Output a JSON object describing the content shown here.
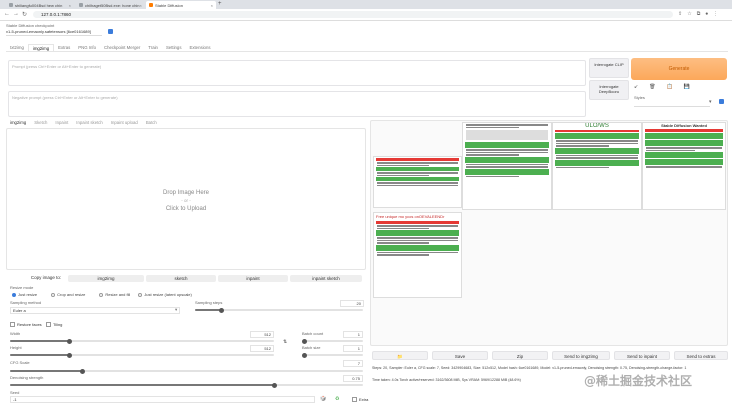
{
  "browser": {
    "tabs": [
      {
        "label": "shiliangfu004Bsd hew chin"
      },
      {
        "label": "chilhaget50Bsd.exe: hone chin"
      },
      {
        "label": "Stable Diffusion"
      }
    ],
    "url": "127.0.0.1:7860"
  },
  "app": {
    "checkpoint_label": "Stable Diffusion checkpoint",
    "checkpoint_value": "v1-5-pruned-emaonly.safetensors [6ce0161689]",
    "main_tabs": [
      "txt2img",
      "img2img",
      "Extras",
      "PNG Info",
      "Checkpoint Merger",
      "Train",
      "Settings",
      "Extensions"
    ],
    "selected_main_tab": "img2img",
    "prompt_placeholder": "Prompt (press Ctrl+Enter or Alt+Enter to generate)",
    "negative_placeholder": "Negative prompt (press Ctrl+Enter or Alt+Enter to generate)",
    "interrogate_clip": "Interrogate CLIP",
    "interrogate_deepbooru": "Interrogate DeepBooru",
    "generate": "Generate",
    "styles_label": "Styles",
    "utility_icons": [
      "↙",
      "🗑",
      "📋",
      "💾"
    ]
  },
  "input_panel": {
    "tabs": [
      "img2img",
      "Sketch",
      "Inpaint",
      "Inpaint sketch",
      "Inpaint upload",
      "Batch"
    ],
    "drop_text": "Drop Image Here",
    "or_text": "- or -",
    "click_text": "Click to Upload",
    "copy_label": "Copy image to:",
    "copy_targets": [
      "img2img",
      "sketch",
      "inpaint",
      "inpaint sketch"
    ],
    "resize_label": "Resize mode",
    "resize_options": [
      "Just resize",
      "Crop and resize",
      "Resize and fill",
      "Just resize (latent upscale)"
    ],
    "resize_selected": "Just resize",
    "sampling_method_label": "Sampling method",
    "sampling_method": "Euler a",
    "sampling_steps_label": "Sampling steps",
    "sampling_steps": "20",
    "restore_faces": "Restore faces",
    "tiling": "Tiling",
    "width_label": "Width",
    "width": "512",
    "height_label": "Height",
    "height": "512",
    "batch_count_label": "Batch count",
    "batch_count": "1",
    "batch_size_label": "Batch size",
    "batch_size": "1",
    "cfg_label": "CFG Scale",
    "cfg": "7",
    "denoise_label": "Denoising strength",
    "denoise": "0.75",
    "seed_label": "Seed",
    "seed": "-1",
    "extra_label": "Extra",
    "script_label": "Script"
  },
  "output_panel": {
    "buttons": [
      "📁",
      "Save",
      "Zip",
      "Send to img2img",
      "Send to inpaint",
      "Send to extras"
    ],
    "info": "Steps: 20, Sampler: Euler a, CFG scale: 7, Seed: 3429904683, Size: 512x512, Model hash: 6ce0161689, Model: v1-5-pruned-emaonly, Denoising strength: 0.75, Denoising-strength-change-factor: 1",
    "time": "Time taken: 4.0s  Torch active/reserved: 3162/3608 MiB, Sys VRAM: 5969/12288 MiB (48.6%)"
  },
  "thumbnails": {
    "t2_heading": "",
    "t3_heading": "ULO/WS",
    "t4_heading": "Stable Diffusion Wanted",
    "t5_heading": "Free unique mo ycos onOEVALEENDr"
  },
  "watermark": "@稀土掘金技术社区",
  "colors": {
    "accent": "#fca85a",
    "link": "#3b7cdb",
    "green": "#4caf50",
    "red": "#e53935"
  }
}
